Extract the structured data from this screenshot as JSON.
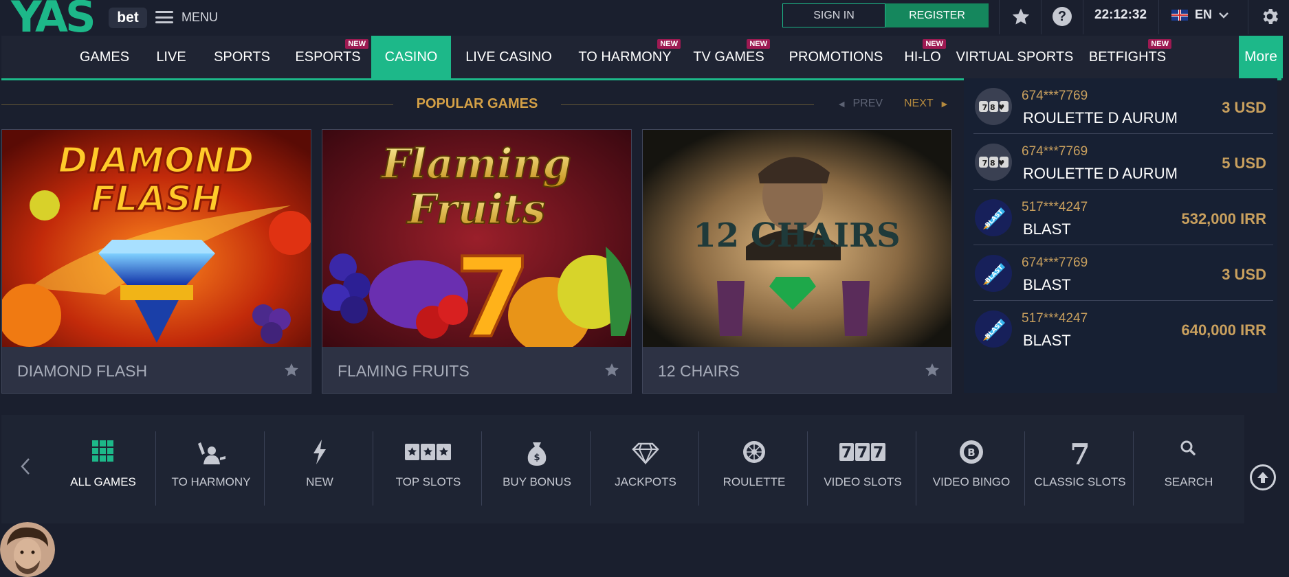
{
  "header": {
    "logo_text": "YAS",
    "logo_suffix": "bet",
    "menu_label": "MENU",
    "signin_label": "SIGN IN",
    "register_label": "REGISTER",
    "help_glyph": "?",
    "clock": "22:12:32",
    "language": "EN",
    "icons": [
      "star-icon",
      "help-icon",
      "uk-flag-icon",
      "chevron-down-icon",
      "gear-icon"
    ]
  },
  "nav": {
    "new_badge": "NEW",
    "items": [
      {
        "label": "GAMES",
        "is_new": false
      },
      {
        "label": "LIVE",
        "is_new": false
      },
      {
        "label": "SPORTS",
        "is_new": false
      },
      {
        "label": "ESPORTS",
        "is_new": true
      },
      {
        "label": "CASINO",
        "is_new": false,
        "active": true
      },
      {
        "label": "LIVE CASINO",
        "is_new": false
      },
      {
        "label": "TO HARMONY",
        "is_new": true
      },
      {
        "label": "TV GAMES",
        "is_new": true
      },
      {
        "label": "PROMOTIONS",
        "is_new": false
      },
      {
        "label": "HI-LO",
        "is_new": true
      },
      {
        "label": "VIRTUAL SPORTS",
        "is_new": false
      },
      {
        "label": "BETFIGHTS",
        "is_new": true
      }
    ],
    "more_label": "More"
  },
  "popular": {
    "title": "POPULAR GAMES",
    "prev_label": "PREV",
    "next_label": "NEXT",
    "cards": [
      {
        "name": "DIAMOND FLASH",
        "art_title": [
          "DIAMOND",
          "FLASH"
        ]
      },
      {
        "name": "FLAMING FRUITS",
        "art_title": [
          "Flaming",
          "Fruits"
        ]
      },
      {
        "name": "12 CHAIRS",
        "art_title": [
          "12 CHAIRS"
        ]
      }
    ]
  },
  "winners": [
    {
      "user": "674***7769",
      "game": "ROULETTE D AURUM",
      "amount": "3 USD",
      "icon": "roulette-dice-icon"
    },
    {
      "user": "674***7769",
      "game": "ROULETTE D AURUM",
      "amount": "5 USD",
      "icon": "roulette-dice-icon"
    },
    {
      "user": "517***4247",
      "game": "BLAST",
      "amount": "532,000 IRR",
      "icon": "blast-rocket-icon"
    },
    {
      "user": "674***7769",
      "game": "BLAST",
      "amount": "3 USD",
      "icon": "blast-rocket-icon"
    },
    {
      "user": "517***4247",
      "game": "BLAST",
      "amount": "640,000 IRR",
      "icon": "blast-rocket-icon"
    }
  ],
  "winner_icon_text": {
    "dice": "7 8 ♥",
    "blast": "BLAST"
  },
  "categories": [
    {
      "label": "ALL GAMES",
      "icon": "grid-icon",
      "active": true
    },
    {
      "label": "TO HARMONY",
      "icon": "juggler-icon"
    },
    {
      "label": "NEW",
      "icon": "lightning-icon"
    },
    {
      "label": "TOP SLOTS",
      "icon": "three-stars-icon"
    },
    {
      "label": "BUY BONUS",
      "icon": "money-bag-icon"
    },
    {
      "label": "JACKPOTS",
      "icon": "diamond-icon"
    },
    {
      "label": "ROULETTE",
      "icon": "roulette-wheel-icon"
    },
    {
      "label": "VIDEO SLOTS",
      "icon": "triple-seven-icon"
    },
    {
      "label": "VIDEO BINGO",
      "icon": "bingo-ball-icon"
    },
    {
      "label": "CLASSIC SLOTS",
      "icon": "seven-icon"
    },
    {
      "label": "SEARCH",
      "icon": "search-icon"
    }
  ],
  "colors": {
    "background": "#1a1f2e",
    "accent_green": "#1db889",
    "gold": "#d4a046",
    "new_badge": "#9e1a52"
  }
}
